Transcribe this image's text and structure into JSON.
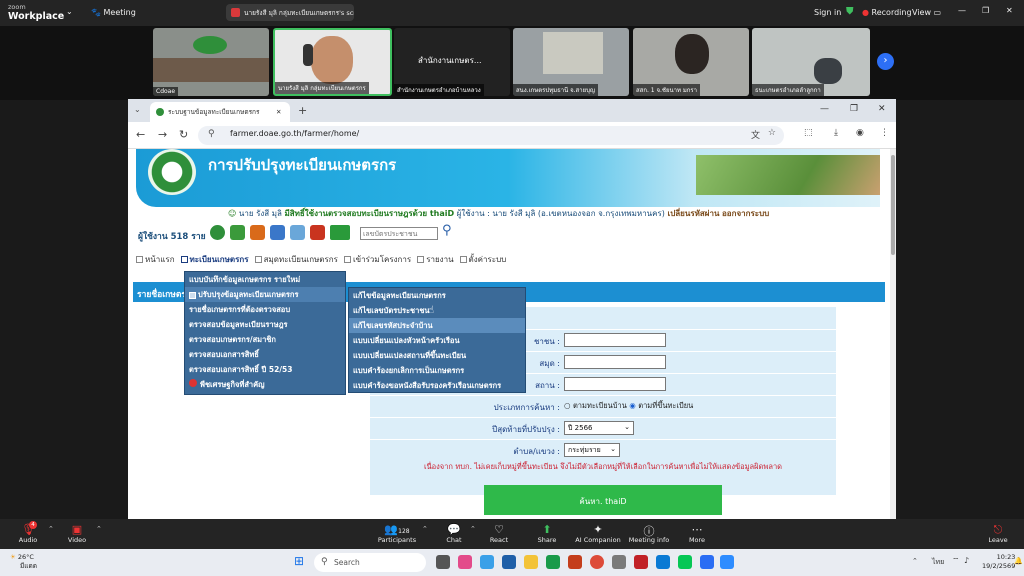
{
  "zoom": {
    "brand_small": "zoom",
    "brand": "Workplace",
    "meeting_label": "Meeting",
    "share_title": "นายรังสี มุลิ กลุ่มทะเบียนเกษตรกร's scr",
    "sign_in": "Sign in",
    "recording": "Recording",
    "view": "View"
  },
  "gallery": [
    {
      "name": "Cdoae"
    },
    {
      "name": "นายรังสี มุลิ กลุ่มทะเบียนเกษตรกร"
    },
    {
      "name": "สำนักงานเกษตรอำเภอบ้านหลวง",
      "big_label": "สำนักงานเกษตร..."
    },
    {
      "name": "สนง.เกษตรปทุมธานี จ.สายบุญ"
    },
    {
      "name": "สสก. 1 จ.ชัยนาท มกรา"
    },
    {
      "name": "ธนะเกษตรอำเภอลำลูกกา"
    }
  ],
  "browser": {
    "tab_title": "ระบบฐานข้อมูลทะเบียนเกษตรกร",
    "url": "farmer.doae.go.th/farmer/home/"
  },
  "page": {
    "banner_title": "การปรับปรุงทะเบียนเกษตรกร",
    "user_prefix": "นาย รังสี มุลิ",
    "user_rights": "มีสิทธิ์ใช้งานตรวจสอบทะเบียนราษฎรด้วย thaiD",
    "user_detail": "ผู้ใช้งาน : นาย รังสี มุลิ (อ.เขตหนองจอก จ.กรุงเทพมหานคร)",
    "change_password": "เปลี่ยนรหัสผ่าน",
    "logout": "ออกจากระบบ",
    "users_count": "ผู้ใช้งาน 518 ราย",
    "id_placeholder": "เลขบัตรประชาชน",
    "menu": [
      "หน้าแรก",
      "ทะเบียนเกษตรกร",
      "สมุดทะเบียนเกษตรกร",
      "เข้าร่วมโครงการ",
      "รายงาน",
      "ตั้งค่าระบบ"
    ],
    "section_header": "รายชื่อเกษตรกร",
    "dropdown1": [
      "แบบบันทึกข้อมูลเกษตรกร รายใหม่",
      "ปรับปรุงข้อมูลทะเบียนเกษตรกร",
      "รายชื่อเกษตรกรที่ต้องตรวจสอบ",
      "ตรวจสอบข้อมูลทะเบียนราษฎร",
      "ตรวจสอบเกษตรกร/สมาชิก",
      "ตรวจสอบเอกสารสิทธิ์",
      "ตรวจสอบเอกสารสิทธิ์ ปี 52/53",
      "พืชเศรษฐกิจที่สำคัญ"
    ],
    "dropdown2": [
      "แก้ไขข้อมูลทะเบียนเกษตรกร",
      "แก้ไขเลขบัตรประชาชน",
      "แก้ไขเลขรหัสประจำบ้าน",
      "แบบเปลี่ยนแปลงหัวหน้าครัวเรือน",
      "แบบเปลี่ยนแปลงสถานที่ขึ้นทะเบียน",
      "แบบคำร้องยกเลิกการเป็นเกษตรกร",
      "แบบคำร้องขอหนังสือรับรองครัวเรือนเกษตรกร"
    ],
    "form": {
      "id_label": "ชาชน :",
      "book_label": "สมุด :",
      "place_label": "สถาน :",
      "search_type_label": "ประเภทการค้นหา :",
      "radio1": "ตามทะเบียนบ้าน",
      "radio2": "ตามที่ขึ้นทะเบียน",
      "year_label": "ปีสุดท้ายที่ปรับปรุง :",
      "year_value": "ปี 2566",
      "subdistrict_label": "ตำบล/แขวง :",
      "subdistrict_value": "กระทุ่มราย",
      "warning": "เนื่องจาก ทบก. ไม่เคยเก็บหมู่ที่ขึ้นทะเบียน จึงไม่มีตัวเลือกหมู่ที่ให้เลือกในการค้นหาเพื่อไม่ให้แสดงข้อมูลผิดพลาด",
      "submit": "ค้นหา. thaiD"
    }
  },
  "toolbar": {
    "audio": "Audio",
    "audio_badge": "4",
    "video": "Video",
    "participants": "Participants",
    "participants_count": "128",
    "chat": "Chat",
    "react": "React",
    "share": "Share",
    "ai": "AI Companion",
    "info": "Meeting info",
    "more": "More",
    "leave": "Leave"
  },
  "taskbar": {
    "weather_temp": "26°C",
    "weather_cond": "มีแดด",
    "search": "Search",
    "lang": "ไทย",
    "time": "10:23",
    "date": "19/2/2569"
  }
}
